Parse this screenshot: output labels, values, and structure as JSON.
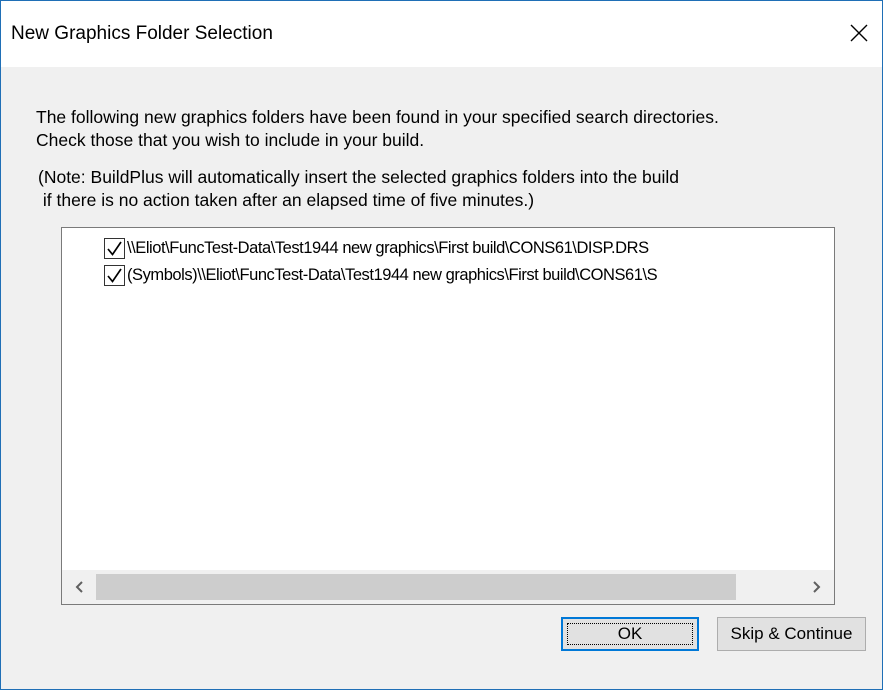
{
  "dialog": {
    "title": "New Graphics Folder Selection",
    "message_line1": "The following new graphics folders have been found in your specified search directories.",
    "message_line2": "Check those that you wish to include in your build.",
    "note_line1": "(Note: BuildPlus will automatically insert the selected graphics folders into the build",
    "note_line2": " if there is no action taken after an elapsed time of five minutes.)"
  },
  "folders": [
    {
      "label": "\\\\Eliot\\FuncTest-Data\\Test1944 new graphics\\First build\\CONS61\\DISP.DRS",
      "checked": true
    },
    {
      "label": "(Symbols)\\\\Eliot\\FuncTest-Data\\Test1944 new graphics\\First build\\CONS61\\S",
      "checked": true
    }
  ],
  "buttons": {
    "ok": "OK",
    "skip": "Skip & Continue"
  },
  "icons": {
    "close": "close-icon",
    "scroll_left": "scroll-left-arrow-icon",
    "scroll_right": "scroll-right-arrow-icon",
    "checkmark": "checkmark-icon"
  },
  "colors": {
    "window_border": "#1f6fb6",
    "dialog_background": "#f0f0f0",
    "default_button_border": "#0078d7"
  }
}
